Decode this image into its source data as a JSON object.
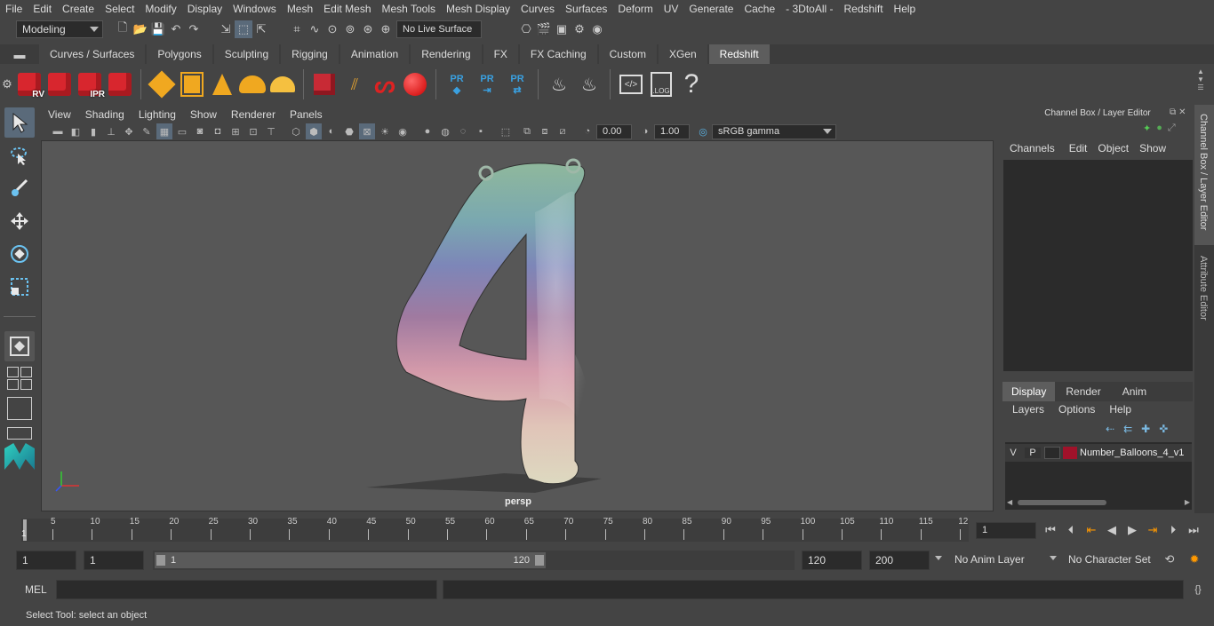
{
  "menu": [
    "File",
    "Edit",
    "Create",
    "Select",
    "Modify",
    "Display",
    "Windows",
    "Mesh",
    "Edit Mesh",
    "Mesh Tools",
    "Mesh Display",
    "Curves",
    "Surfaces",
    "Deform",
    "UV",
    "Generate",
    "Cache",
    "- 3DtoAll -",
    "Redshift",
    "Help"
  ],
  "status": {
    "mode": "Modeling",
    "live_surface": "No Live Surface"
  },
  "shelf_tabs": [
    "Curves / Surfaces",
    "Polygons",
    "Sculpting",
    "Rigging",
    "Animation",
    "Rendering",
    "FX",
    "FX Caching",
    "Custom",
    "XGen",
    "Redshift"
  ],
  "shelf_active": "Redshift",
  "shelf_labels": {
    "rv": "RV",
    "ipr": "IPR",
    "pr1": "PR",
    "pr2": "PR",
    "pr3": "PR",
    "log": ".LOG",
    "help": "?"
  },
  "viewport": {
    "menu": [
      "View",
      "Shading",
      "Lighting",
      "Show",
      "Renderer",
      "Panels"
    ],
    "exposure": "0.00",
    "gamma": "1.00",
    "colorspace": "sRGB gamma",
    "camera_label": "persp"
  },
  "channel_box": {
    "title": "Channel Box / Layer Editor",
    "menu": [
      "Channels",
      "Edit",
      "Object",
      "Show"
    ],
    "layer_tabs": [
      "Display",
      "Render",
      "Anim"
    ],
    "layer_menu": [
      "Layers",
      "Options",
      "Help"
    ],
    "layer": {
      "v": "V",
      "p": "P",
      "name": "Number_Balloons_4_v1",
      "color": "#a0122a"
    }
  },
  "side_tabs": [
    "Channel Box / Layer Editor",
    "Attribute Editor"
  ],
  "timeline": {
    "ticks": [
      "5",
      "10",
      "15",
      "20",
      "25",
      "30",
      "35",
      "40",
      "45",
      "50",
      "55",
      "60",
      "65",
      "70",
      "75",
      "80",
      "85",
      "90",
      "95",
      "100",
      "105",
      "110",
      "115",
      "12"
    ],
    "current_frame": "1",
    "start_marker": "1"
  },
  "range": {
    "start": "1",
    "playback_start": "1",
    "slider_start": "1",
    "slider_end": "120",
    "playback_end": "120",
    "end": "200",
    "anim_layer": "No Anim Layer",
    "character_set": "No Character Set"
  },
  "cmdline": {
    "lang": "MEL"
  },
  "help_line": "Select Tool: select an object"
}
